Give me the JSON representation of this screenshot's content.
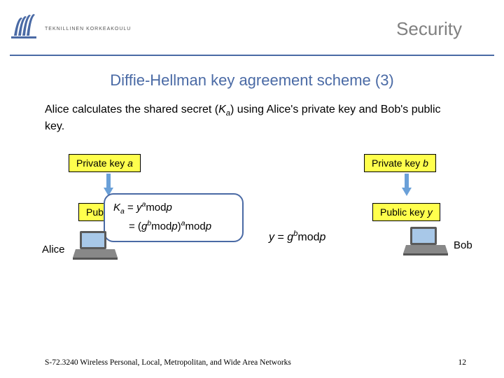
{
  "header": {
    "org": "TEKNILLINEN KORKEAKOULU",
    "title": "Security"
  },
  "slide": {
    "title": "Diffie-Hellman key agreement scheme (3)",
    "body_pre": "Alice calculates the shared secret (",
    "body_k": "K",
    "body_ksub": "a",
    "body_post": ") using Alice's private key and Bob's public key."
  },
  "boxes": {
    "priv_a_pre": "Private key ",
    "priv_a_var": "a",
    "pub_a_pre": "Pub",
    "priv_b_pre": "Private key ",
    "priv_b_var": "b",
    "pub_b_pre": "Public key ",
    "pub_b_var": "y"
  },
  "callout": {
    "lhs_k": "K",
    "lhs_sub": "a",
    "eq": " = ",
    "r1_y": "y",
    "r1_sup": "a",
    "r1_mod": "mod",
    "r1_p": "p",
    "r2_eq": "= (",
    "r2_g": "g",
    "r2_bsup": "b",
    "r2_mod1": "mod",
    "r2_p1": "p",
    "r2_close": ")",
    "r2_asup": "a",
    "r2_mod2": "mod",
    "r2_p2": "p"
  },
  "eq_y": {
    "y": "y",
    "eq": " = ",
    "g": "g",
    "bsup": "b",
    "mod": "mod",
    "p": "p"
  },
  "people": {
    "alice": "Alice",
    "bob": "Bob"
  },
  "footer": {
    "left": "S-72.3240 Wireless Personal, Local, Metropolitan, and Wide Area Networks",
    "page": "12"
  }
}
